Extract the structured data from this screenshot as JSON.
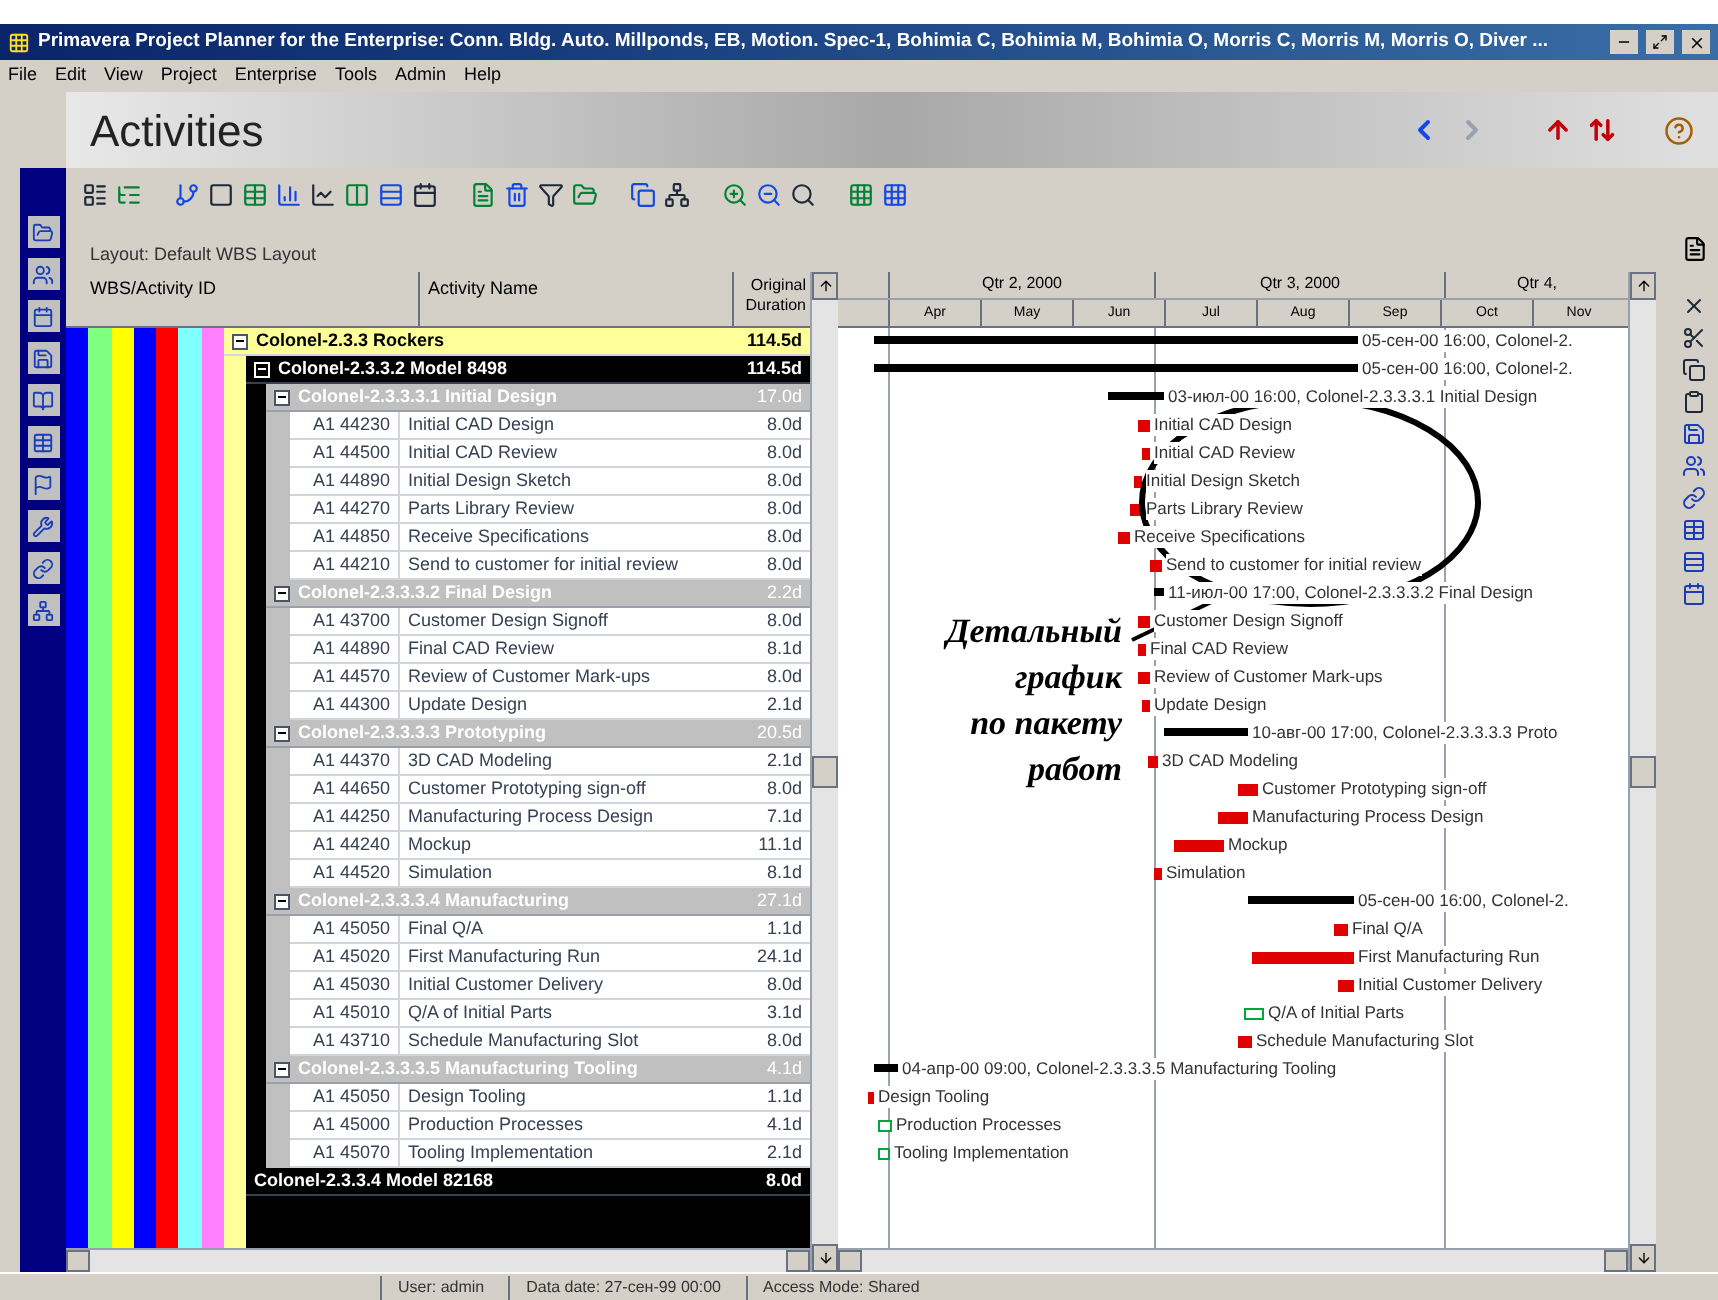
{
  "window": {
    "title": "Primavera Project Planner for the Enterprise: Conn. Bldg. Auto. Millponds, EB, Motion. Spec-1, Bohimia C, Bohimia M, Bohimia O, Morris C, Morris M, Morris O, Diver ..."
  },
  "menu": [
    "File",
    "Edit",
    "View",
    "Project",
    "Enterprise",
    "Tools",
    "Admin",
    "Help"
  ],
  "header": {
    "title": "Activities"
  },
  "layout": {
    "label": "Layout: Default WBS Layout"
  },
  "columns": [
    "WBS/Activity ID",
    "Activity Name",
    "Original Duration"
  ],
  "timescale": {
    "quarters": [
      "Qtr 2, 2000",
      "Qtr 3, 2000",
      "Qtr 4,"
    ],
    "months": [
      "Apr",
      "May",
      "Jun",
      "Jul",
      "Aug",
      "Sep",
      "Oct",
      "Nov"
    ]
  },
  "rows": [
    {
      "name": "Colonel-2.3.3  Rockers",
      "duration": "114.5d",
      "expanded": true,
      "bar_label": "05-сен-00 16:00, Colonel-2.",
      "children": [
        {
          "name": "Colonel-2.3.3.2  Model 8498",
          "duration": "114.5d",
          "expanded": true,
          "bar_label": "05-сен-00 16:00, Colonel-2.",
          "children": [
            {
              "name": "Colonel-2.3.3.3.1  Initial Design",
              "duration": "17.0d",
              "expanded": true,
              "bar_label": "03-июл-00 16:00, Colonel-2.3.3.3.1  Initial Design",
              "children": [
                {
                  "id": "A1 44230",
                  "name": "Initial CAD Design",
                  "duration": "8.0d",
                  "bar_label": "Initial CAD Design"
                },
                {
                  "id": "A1 44500",
                  "name": "Initial CAD Review",
                  "duration": "8.0d",
                  "bar_label": "Initial CAD Review"
                },
                {
                  "id": "A1 44890",
                  "name": "Initial Design Sketch",
                  "duration": "8.0d",
                  "bar_label": "Initial Design Sketch"
                },
                {
                  "id": "A1 44270",
                  "name": "Parts Library Review",
                  "duration": "8.0d",
                  "bar_label": "Parts Library Review"
                },
                {
                  "id": "A1 44850",
                  "name": "Receive Specifications",
                  "duration": "8.0d",
                  "bar_label": "Receive Specifications"
                },
                {
                  "id": "A1 44210",
                  "name": "Send to customer for initial review",
                  "duration": "8.0d",
                  "bar_label": "Send to customer for initial review"
                }
              ]
            },
            {
              "name": "Colonel-2.3.3.3.2  Final Design",
              "duration": "2.2d",
              "expanded": true,
              "bar_label": "11-июл-00 17:00, Colonel-2.3.3.3.2  Final Design",
              "children": [
                {
                  "id": "A1 43700",
                  "name": "Customer Design Signoff",
                  "duration": "8.0d",
                  "bar_label": "Customer Design Signoff"
                },
                {
                  "id": "A1 44890",
                  "name": "Final CAD Review",
                  "duration": "8.1d",
                  "bar_label": "Final CAD Review"
                },
                {
                  "id": "A1 44570",
                  "name": "Review of Customer Mark-ups",
                  "duration": "8.0d",
                  "bar_label": "Review of Customer Mark-ups"
                },
                {
                  "id": "A1 44300",
                  "name": "Update Design",
                  "duration": "2.1d",
                  "bar_label": "Update Design"
                }
              ]
            },
            {
              "name": "Colonel-2.3.3.3.3  Prototyping",
              "duration": "20.5d",
              "expanded": true,
              "bar_label": "10-авг-00 17:00, Colonel-2.3.3.3.3  Proto",
              "children": [
                {
                  "id": "A1 44370",
                  "name": "3D CAD Modeling",
                  "duration": "2.1d",
                  "bar_label": "3D CAD Modeling"
                },
                {
                  "id": "A1 44650",
                  "name": "Customer Prototyping sign-off",
                  "duration": "8.0d",
                  "bar_label": "Customer Prototyping sign-off"
                },
                {
                  "id": "A1 44250",
                  "name": "Manufacturing Process Design",
                  "duration": "7.1d",
                  "bar_label": "Manufacturing Process Design"
                },
                {
                  "id": "A1 44240",
                  "name": "Mockup",
                  "duration": "11.1d",
                  "bar_label": "Mockup"
                },
                {
                  "id": "A1 44520",
                  "name": "Simulation",
                  "duration": "8.1d",
                  "bar_label": "Simulation"
                }
              ]
            },
            {
              "name": "Colonel-2.3.3.3.4  Manufacturing",
              "duration": "27.1d",
              "expanded": true,
              "bar_label": "05-сен-00 16:00, Colonel-2.",
              "children": [
                {
                  "id": "A1 45050",
                  "name": "Final Q/A",
                  "duration": "1.1d",
                  "bar_label": "Final Q/A"
                },
                {
                  "id": "A1 45020",
                  "name": "First Manufacturing Run",
                  "duration": "24.1d",
                  "bar_label": "First Manufacturing Run"
                },
                {
                  "id": "A1 45030",
                  "name": "Initial Customer Delivery",
                  "duration": "8.0d",
                  "bar_label": "Initial Customer Delivery"
                },
                {
                  "id": "A1 45010",
                  "name": "Q/A of Initial Parts",
                  "duration": "3.1d",
                  "bar_label": "Q/A of Initial Parts"
                },
                {
                  "id": "A1 43710",
                  "name": "Schedule Manufacturing Slot",
                  "duration": "8.0d",
                  "bar_label": "Schedule Manufacturing Slot"
                }
              ]
            },
            {
              "name": "Colonel-2.3.3.3.5  Manufacturing Tooling",
              "duration": "4.1d",
              "expanded": true,
              "bar_label": "04-апр-00 09:00, Colonel-2.3.3.3.5  Manufacturing Tooling",
              "children": [
                {
                  "id": "A1 45050",
                  "name": "Design Tooling",
                  "duration": "1.1d",
                  "bar_label": "Design Tooling"
                },
                {
                  "id": "A1 45000",
                  "name": "Production Processes",
                  "duration": "4.1d",
                  "bar_label": "Production Processes"
                },
                {
                  "id": "A1 45070",
                  "name": "Tooling Implementation",
                  "duration": "2.1d",
                  "bar_label": "Tooling Implementation"
                }
              ]
            }
          ]
        },
        {
          "name": "Colonel-2.3.3.4  Model 82168",
          "duration": "8.0d"
        }
      ]
    }
  ],
  "annotation": [
    "Детальный",
    "график",
    "по пакету",
    "работ"
  ],
  "status_bar": [
    "User: admin",
    "Data date: 27-сен-99 00:00",
    "Access Mode: Shared"
  ]
}
